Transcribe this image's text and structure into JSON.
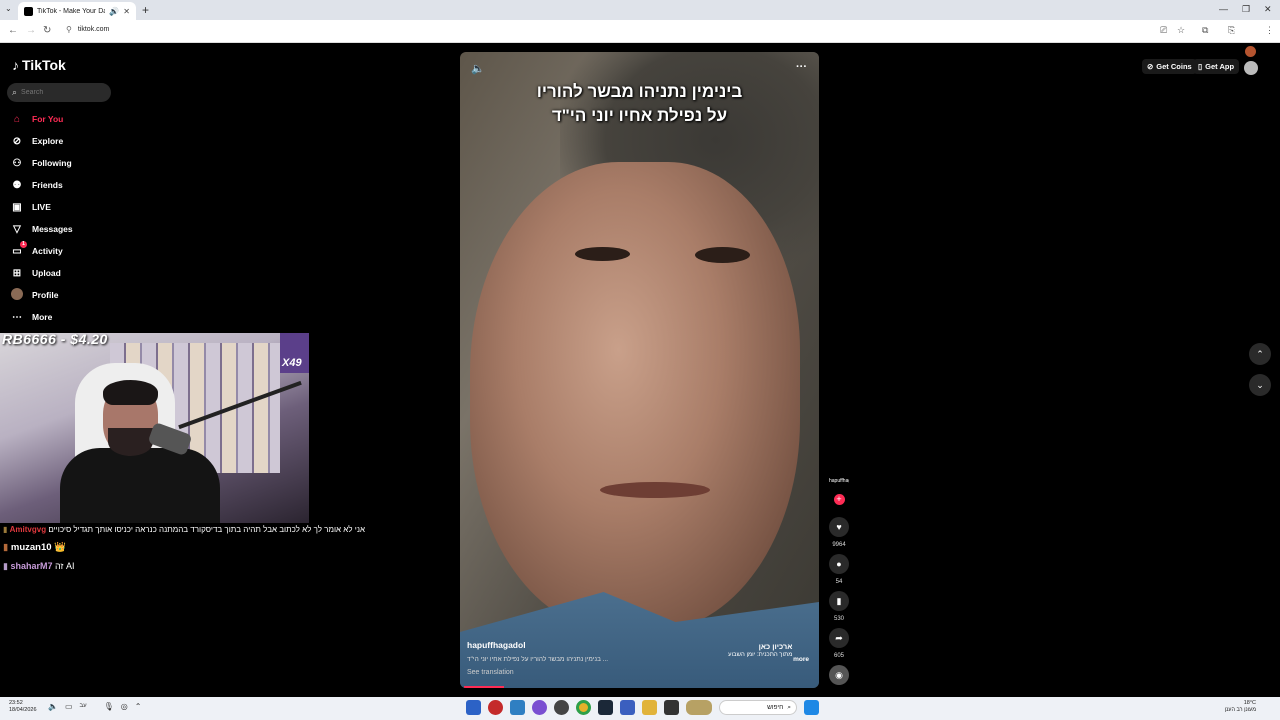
{
  "browser": {
    "tab_title": "TikTok - Make Your Day",
    "url": "tiktok.com"
  },
  "sidebar": {
    "brand": "TikTok",
    "search_placeholder": "Search",
    "items": [
      {
        "label": "For You",
        "icon": "home-icon",
        "active": true
      },
      {
        "label": "Explore",
        "icon": "compass-icon"
      },
      {
        "label": "Following",
        "icon": "user-follow-icon"
      },
      {
        "label": "Friends",
        "icon": "friends-icon"
      },
      {
        "label": "LIVE",
        "icon": "live-icon"
      },
      {
        "label": "Messages",
        "icon": "send-icon"
      },
      {
        "label": "Activity",
        "icon": "inbox-icon",
        "badge": "1"
      },
      {
        "label": "Upload",
        "icon": "plus-square-icon"
      },
      {
        "label": "Profile",
        "icon": "avatar-icon"
      },
      {
        "label": "More",
        "icon": "more-dots-icon"
      }
    ]
  },
  "stream_overlay": {
    "donation_text": "RB6666 - $4.20",
    "multiplier": "X49"
  },
  "chat": [
    {
      "user": "Amitvgvg",
      "text": "אני לא אומר לך לא לכתוב אבל תהיה בתוך בדיסקורד בהמתנה כנראה יכניסו אותך תגדיל סיכויים",
      "color": "#e0393e"
    },
    {
      "user": "muzan10",
      "text": "",
      "color": "#ffffff"
    },
    {
      "user": "shaharM7",
      "text": "זה AI",
      "color": "#c79bd9"
    }
  ],
  "video": {
    "caption_line1": "בינימין נתניהו מבשר להוריו",
    "caption_line2": "על נפילת אחיו יוני הי\"ד",
    "username": "hapuffhagadol",
    "description": "בנימין נתניהו מבשר להוריו על נפילת אחיו יוני הי\"ד ...",
    "more_label": "more",
    "see_translation": "See translation",
    "watermark_line1": "ארכיון כאן",
    "watermark_line2": "מתוך התכנית: יומן השבוע"
  },
  "actions": {
    "creator_label": "hapuffhagadol",
    "likes": "9964",
    "comments": "54",
    "saves": "530",
    "shares": "605"
  },
  "header_right": {
    "get_coins": "Get Coins",
    "get_app": "Get App"
  },
  "taskbar": {
    "time": "23:52",
    "date": "18/04/2026",
    "lang": "עב",
    "search_placeholder": "חיפוש",
    "weather_temp": "18°C",
    "weather_desc": "מעונן רב הענן"
  }
}
